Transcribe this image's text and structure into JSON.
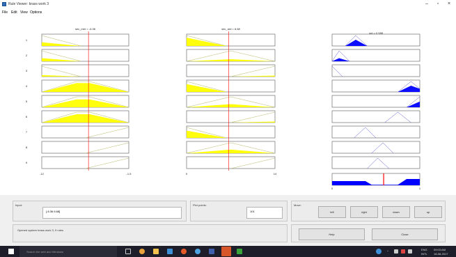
{
  "window": {
    "title": "Rule Viewer: brass work 3",
    "controls": [
      "–",
      "▫",
      "×"
    ]
  },
  "menu": [
    "File",
    "Edit",
    "View",
    "Options"
  ],
  "inputs": [
    {
      "title": "sec_mer = -6.36",
      "min_tick": "-12",
      "max_tick": "-1.5"
    },
    {
      "title": "sec_ard = 6.68",
      "min_tick": "0",
      "max_tick": "14"
    }
  ],
  "output": {
    "title": "opt = 0.588",
    "min_tick": "0",
    "max_tick": "1"
  },
  "rules": [
    "1",
    "2",
    "3",
    "4",
    "5",
    "6",
    "7",
    "8",
    "9"
  ],
  "input_panel": {
    "label": "Input:",
    "value": "[-6.36 6.68]"
  },
  "plot_points": {
    "label": "Plot points:",
    "value": "101"
  },
  "move": {
    "label": "Move:",
    "buttons": [
      "left",
      "right",
      "down",
      "up"
    ]
  },
  "status": {
    "text": "Opened system brass work 3, 9 rules"
  },
  "actions": {
    "help": "Help",
    "close": "Close"
  },
  "taskbar": {
    "search": "Search the web and Windows",
    "lang": "ENG",
    "region": "INTL",
    "time": "09:03 AM",
    "date": "18-08-2017"
  },
  "colors": {
    "fill_input": "#ffff00",
    "fill_output": "#0000ff",
    "crosshair": "#ff0000"
  }
}
